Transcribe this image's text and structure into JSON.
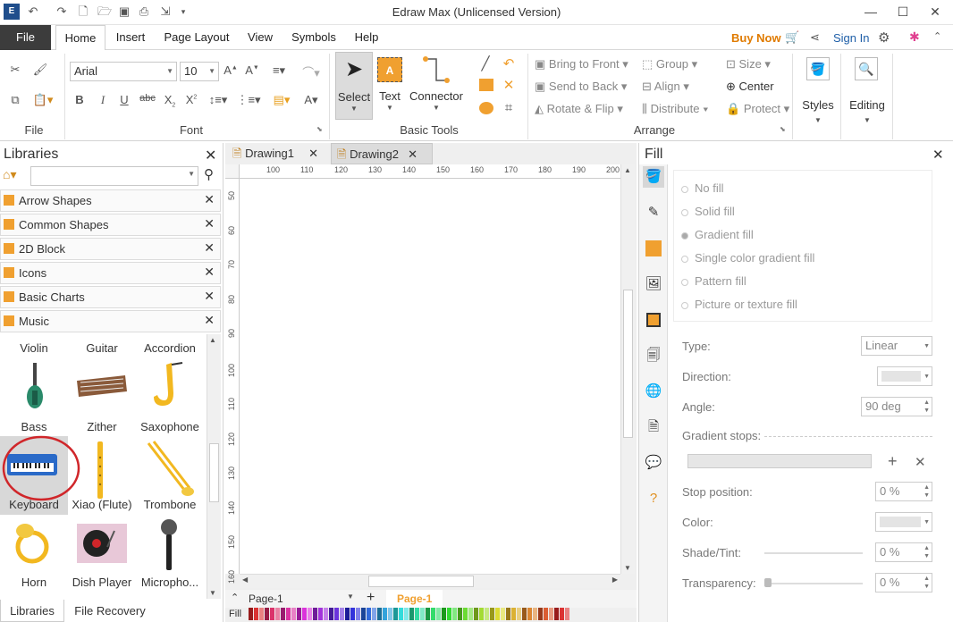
{
  "app": {
    "title": "Edraw Max (Unlicensed Version)"
  },
  "menu": {
    "file": "File",
    "tabs": [
      "Home",
      "Insert",
      "Page Layout",
      "View",
      "Symbols",
      "Help"
    ],
    "buy_now": "Buy Now",
    "sign_in": "Sign In"
  },
  "ribbon": {
    "file_group_label": "File",
    "font_group_label": "Font",
    "font_name": "Arial",
    "font_size": "10",
    "basic_tools_label": "Basic Tools",
    "select_label": "Select",
    "text_label": "Text",
    "connector_label": "Connector",
    "arrange_label": "Arrange",
    "bring_to_front": "Bring to Front",
    "send_to_back": "Send to Back",
    "rotate_flip": "Rotate & Flip",
    "group": "Group",
    "align": "Align",
    "distribute": "Distribute",
    "size": "Size",
    "center": "Center",
    "protect": "Protect",
    "styles": "Styles",
    "editing": "Editing"
  },
  "libraries": {
    "title": "Libraries",
    "items": [
      "Arrow Shapes",
      "Common Shapes",
      "2D Block",
      "Icons",
      "Basic Charts",
      "Music"
    ],
    "shapes_top_row": [
      "Violin",
      "Guitar",
      "Accordion"
    ],
    "shapes": [
      {
        "label": "Bass"
      },
      {
        "label": "Zither"
      },
      {
        "label": "Saxophone"
      },
      {
        "label": "Keyboard"
      },
      {
        "label": "Xiao (Flute)"
      },
      {
        "label": "Trombone"
      },
      {
        "label": "Horn"
      },
      {
        "label": "Dish Player"
      },
      {
        "label": "Micropho..."
      }
    ],
    "bottom_tabs": [
      "Libraries",
      "File Recovery"
    ]
  },
  "documents": {
    "tabs": [
      "Drawing1",
      "Drawing2"
    ],
    "active_tab": "Drawing2",
    "ruler_top": [
      "100",
      "110",
      "120",
      "130",
      "140",
      "150",
      "160",
      "170",
      "180",
      "190",
      "200"
    ],
    "ruler_left": [
      "50",
      "60",
      "70",
      "80",
      "90",
      "100",
      "110",
      "120",
      "130",
      "140",
      "150",
      "160"
    ],
    "page_tab": "Page-1",
    "active_page": "Page-1",
    "fill_label": "Fill"
  },
  "fill_panel": {
    "title": "Fill",
    "options": [
      "No fill",
      "Solid fill",
      "Gradient fill",
      "Single color gradient fill",
      "Pattern fill",
      "Picture or texture fill"
    ],
    "selected": "Gradient fill",
    "type_label": "Type:",
    "type_value": "Linear",
    "direction_label": "Direction:",
    "angle_label": "Angle:",
    "angle_value": "90 deg",
    "gradient_stops_label": "Gradient stops:",
    "stop_position_label": "Stop position:",
    "stop_position_value": "0 %",
    "color_label": "Color:",
    "shade_label": "Shade/Tint:",
    "shade_value": "0 %",
    "transparency_label": "Transparency:",
    "transparency_value": "0 %"
  },
  "colors": {
    "accent_orange": "#f0a030",
    "file_tab_bg": "#3c3c3c",
    "buy_now": "#e07b00",
    "sign_in": "#1f5fa8",
    "selection_circle": "#d0262a"
  }
}
